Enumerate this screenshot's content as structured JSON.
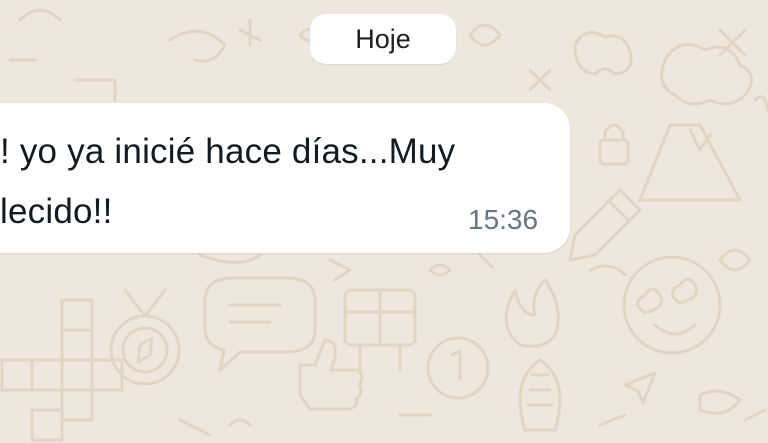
{
  "date_separator": {
    "label": "Hoje"
  },
  "message": {
    "line1": "! yo ya inicié hace días...Muy",
    "line2": "lecido!!",
    "time": "15:36",
    "direction": "incoming"
  },
  "colors": {
    "wallpaper": "#efe7dd",
    "doodle": "#e3d5c3",
    "bubble": "#ffffff",
    "text": "#111b21",
    "timestamp": "#667781"
  },
  "wallpaper_icons": [
    "crossword-icon",
    "compass-icon",
    "chat-bubble-icon",
    "gift-box-icon",
    "clock-icon",
    "fire-icon",
    "heart-eyes-emoji-icon",
    "volcano-icon",
    "pencil-icon",
    "lock-icon",
    "thumbs-up-icon",
    "corn-icon",
    "paper-plane-icon"
  ]
}
